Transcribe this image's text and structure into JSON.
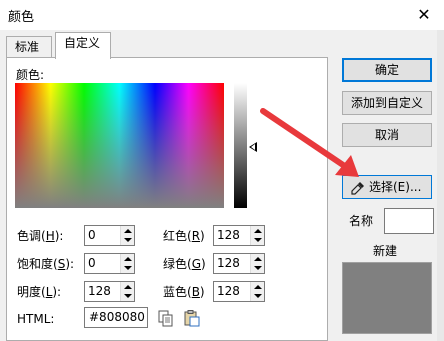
{
  "window": {
    "title": "颜色",
    "close_glyph": "✕"
  },
  "tabs": {
    "standard": "标准",
    "custom": "自定义"
  },
  "color_section": {
    "label": "颜色:"
  },
  "fields": {
    "hue": {
      "label_pre": "色调(",
      "key": "H",
      "label_post": "):",
      "value": "0"
    },
    "saturation": {
      "label_pre": "饱和度(",
      "key": "S",
      "label_post": "):",
      "value": "0"
    },
    "luminance": {
      "label_pre": "明度(",
      "key": "L",
      "label_post": "):",
      "value": "128"
    },
    "red": {
      "label_pre": "红色(",
      "key": "R",
      "label_post": ")",
      "value": "128"
    },
    "green": {
      "label_pre": "绿色(",
      "key": "G",
      "label_post": ")",
      "value": "128"
    },
    "blue": {
      "label_pre": "蓝色(",
      "key": "B",
      "label_post": ")",
      "value": "128"
    },
    "html": {
      "label": "HTML:",
      "value": "#808080"
    }
  },
  "buttons": {
    "ok": "确定",
    "add_custom": "添加到自定义",
    "cancel": "取消",
    "pick": "选择(E)..."
  },
  "name": {
    "label": "名称",
    "value": ""
  },
  "new": {
    "label": "新建"
  },
  "colors": {
    "current": "#808080",
    "annotation_arrow": "#e8393c",
    "focus": "#0078d7"
  },
  "icons": [
    "copy-icon",
    "paste-icon",
    "eyedropper-icon"
  ]
}
